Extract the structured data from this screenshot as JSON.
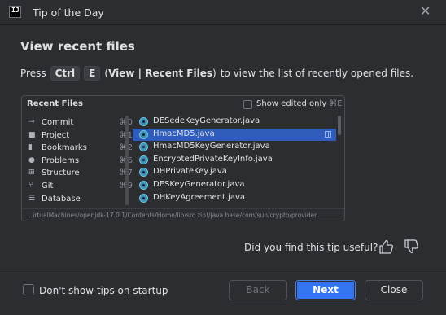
{
  "window": {
    "title": "Tip of the Day"
  },
  "tip": {
    "heading": "View recent files",
    "press": "Press",
    "key1": "Ctrl",
    "key2": "E",
    "paren_open": "(",
    "action": "View | Recent Files",
    "paren_close": ")",
    "suffix": "to view the list of recently opened files."
  },
  "recent_files_popup": {
    "title": "Recent Files",
    "show_edited_label": "Show edited only",
    "show_edited_shortcut": "⌘E",
    "nav_items": [
      {
        "label": "Commit",
        "shortcut": "⌘0",
        "icon": "commit-icon"
      },
      {
        "label": "Project",
        "shortcut": "⌘1",
        "icon": "folder-icon"
      },
      {
        "label": "Bookmarks",
        "shortcut": "⌘2",
        "icon": "bookmark-icon"
      },
      {
        "label": "Problems",
        "shortcut": "⌘6",
        "icon": "problems-icon"
      },
      {
        "label": "Structure",
        "shortcut": "⌘7",
        "icon": "structure-icon"
      },
      {
        "label": "Git",
        "shortcut": "⌘9",
        "icon": "git-icon"
      },
      {
        "label": "Database",
        "shortcut": "",
        "icon": "database-icon"
      }
    ],
    "files": [
      {
        "name": "DESedeKeyGenerator.java",
        "selected": false
      },
      {
        "name": "HmacMD5.java",
        "selected": true
      },
      {
        "name": "HmacMD5KeyGenerator.java",
        "selected": false
      },
      {
        "name": "EncryptedPrivateKeyInfo.java",
        "selected": false
      },
      {
        "name": "DHPrivateKey.java",
        "selected": false
      },
      {
        "name": "DESKeyGenerator.java",
        "selected": false
      },
      {
        "name": "DHKeyAgreement.java",
        "selected": false
      }
    ],
    "path": "...irtualMachines/openjdk-17.0.1/Contents/Home/lib/src.zip!/java.base/com/sun/crypto/provider"
  },
  "feedback": {
    "question": "Did you find this tip useful?"
  },
  "footer": {
    "dont_show_label": "Don't show tips on startup",
    "back_label": "Back",
    "next_label": "Next",
    "close_label": "Close"
  },
  "colors": {
    "background": "#2b2d30",
    "selection": "#2e5cb8",
    "primary_button": "#3574f0",
    "text": "#dfe1e5"
  }
}
